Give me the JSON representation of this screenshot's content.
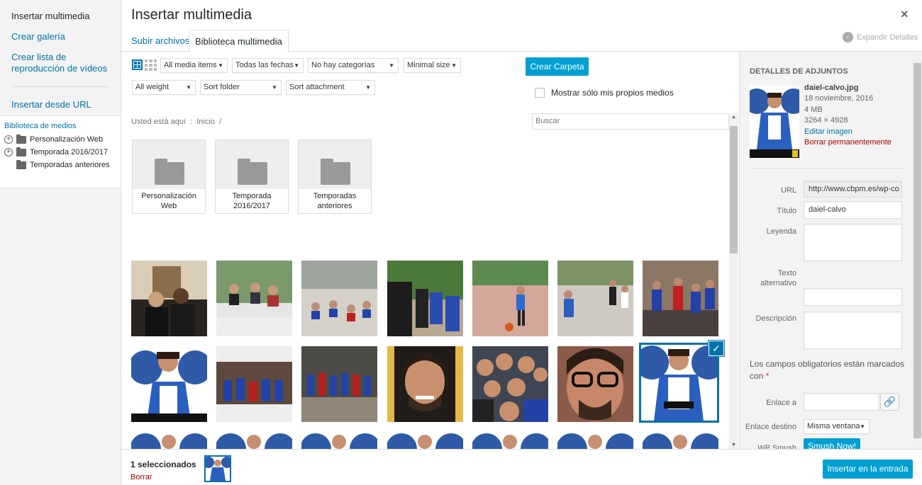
{
  "sidebar": {
    "title": "Insertar multimedia",
    "items": [
      {
        "label": "Crear galería"
      },
      {
        "label": "Crear lista de reproducción de vídeos"
      },
      {
        "label": "Insertar desde URL"
      }
    ],
    "tree_title": "Biblioteca de medios",
    "tree": [
      {
        "label": "Personalización Web",
        "expandable": true
      },
      {
        "label": "Temporada 2016/2017",
        "expandable": true
      },
      {
        "label": "Temporadas anteriores",
        "expandable": false
      }
    ]
  },
  "header": {
    "title": "Insertar multimedia",
    "close": "×",
    "tabs": [
      {
        "label": "Subir archivos"
      },
      {
        "label": "Biblioteca multimedia"
      }
    ],
    "expand_label": "Expandir Detalles"
  },
  "toolbar": {
    "filters": [
      "All media items",
      "Todas las fechas",
      "No hay categorías",
      "Minimal size"
    ],
    "filters2": [
      "All weight",
      "Sort folder",
      "Sort attachment"
    ],
    "create_folder": "Crear Carpeta",
    "only_mine": "Mostrar sólo mis propios medios",
    "breadcrumb": "Usted está aquí  :  Inicio  /",
    "search_placeholder": "Buscar"
  },
  "folders": [
    {
      "label": "Personalización Web"
    },
    {
      "label": "Temporada 2016/2017"
    },
    {
      "label": "Temporadas anteriores"
    }
  ],
  "details": {
    "heading": "DETALLES DE ADJUNTOS",
    "filename": "daiel-calvo.jpg",
    "date": "18 noviembre, 2016",
    "size": "4 MB",
    "dimensions": "3264 × 4928",
    "edit": "Editar imagen",
    "delete": "Borrar permanentemente",
    "fields": {
      "url_label": "URL",
      "url_value": "http://www.cbpm.es/wp-co",
      "title_label": "Título",
      "title_value": "daiel-calvo",
      "caption_label": "Leyenda",
      "alt_label": "Texto alternativo",
      "desc_label": "Descripción",
      "required_note": "Los campos obligatorios están marcados con",
      "link_label": "Enlace a",
      "target_label": "Enlace destino",
      "target_value": "Misma ventana",
      "smush_label": "WP Smush",
      "smush_button": "Smush Now!"
    }
  },
  "footer": {
    "count": "1 seleccionados",
    "clear": "Borrar",
    "insert": "Insertar en la entrada"
  },
  "colors": {
    "accent": "#00a0d2",
    "link": "#0073aa",
    "danger": "#a00"
  }
}
